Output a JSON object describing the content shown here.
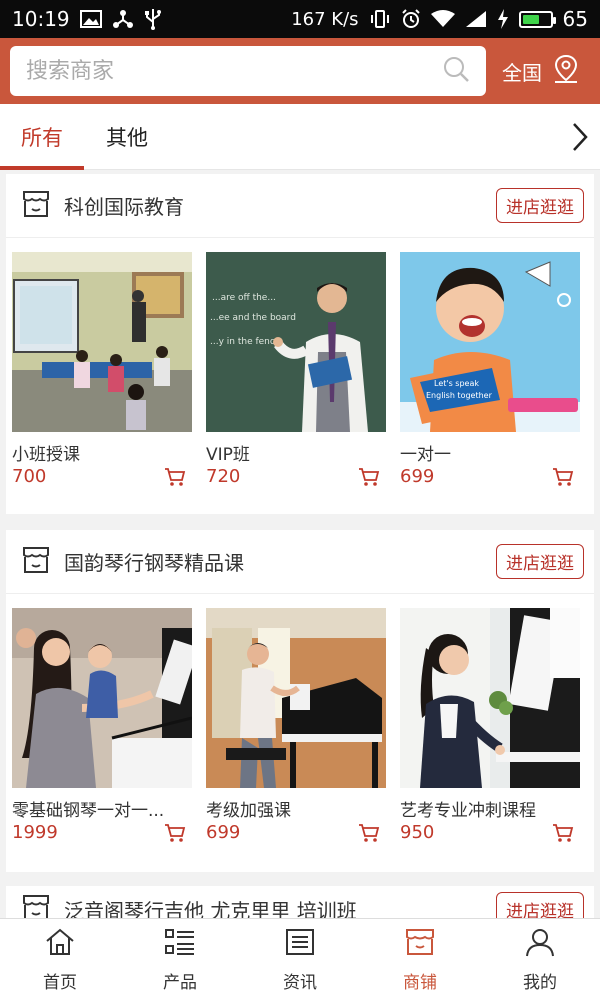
{
  "status_bar": {
    "time": "10:19",
    "net_speed": "167 K/s",
    "battery_level": "65",
    "battery_fraction": 0.65,
    "icons": [
      "image-icon",
      "share-icon",
      "usb-icon",
      "vibrate-icon",
      "alarm-icon",
      "wifi-icon",
      "signal-icon",
      "charge-icon",
      "battery-icon"
    ]
  },
  "search": {
    "placeholder": "搜索商家"
  },
  "region": {
    "label": "全国"
  },
  "tabs": [
    {
      "label": "所有",
      "active": true
    },
    {
      "label": "其他",
      "active": false
    }
  ],
  "stores": [
    {
      "name": "科创国际教育",
      "visit_label": "进店逛逛",
      "products": [
        {
          "name": "小班授课",
          "price": "700"
        },
        {
          "name": "VIP班",
          "price": "720"
        },
        {
          "name": "一对一",
          "price": "699"
        }
      ]
    },
    {
      "name": "国韵琴行钢琴精品课",
      "visit_label": "进店逛逛",
      "products": [
        {
          "name": "零基础钢琴一对一...",
          "price": "1999"
        },
        {
          "name": "考级加强课",
          "price": "699"
        },
        {
          "name": "艺考专业冲刺课程",
          "price": "950"
        }
      ]
    },
    {
      "name": "泛音阁琴行吉他 尤克里里 培训班",
      "visit_label": "进店逛逛"
    }
  ],
  "thumb_texts": {
    "vip_board_lines": [
      "...are off the...",
      "...ee and the board",
      "...y in the fence"
    ],
    "book_lines": [
      "Let's speak",
      "English together"
    ]
  },
  "bottom_nav": [
    {
      "label": "首页",
      "icon": "home-icon",
      "active": false
    },
    {
      "label": "产品",
      "icon": "list-icon",
      "active": false
    },
    {
      "label": "资讯",
      "icon": "news-icon",
      "active": false
    },
    {
      "label": "商铺",
      "icon": "store-icon",
      "active": true
    },
    {
      "label": "我的",
      "icon": "profile-icon",
      "active": false
    }
  ],
  "colors": {
    "brand": "#c9573c",
    "accent_red": "#c0392b",
    "active_tab": "#c13a2a"
  }
}
